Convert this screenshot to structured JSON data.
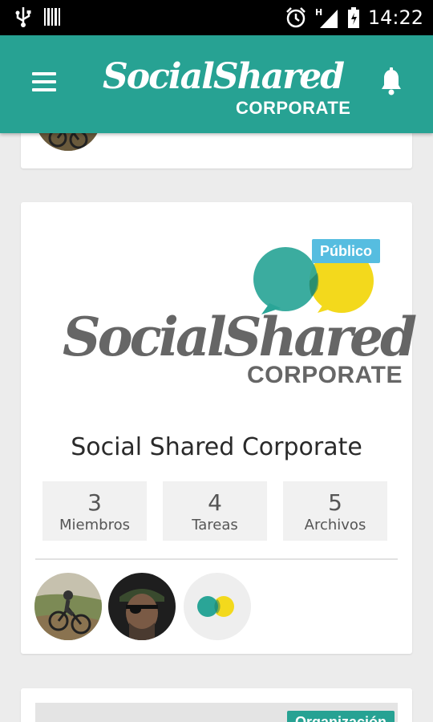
{
  "status_bar": {
    "time": "14:22",
    "icons": [
      "usb-icon",
      "barcode-icon",
      "alarm-icon",
      "signal-icon",
      "battery-icon"
    ]
  },
  "app_bar": {
    "logo_main": "SocialShared",
    "logo_sub": "CORPORATE",
    "icons": [
      "menu-icon",
      "bell-icon"
    ],
    "color": "#27a293"
  },
  "group_card": {
    "visibility": "Público",
    "cover_logo_main": "SocialShared",
    "cover_logo_sub": "CORPORATE",
    "title": "Social Shared Corporate",
    "stats": [
      {
        "value": "3",
        "label": "Miembros"
      },
      {
        "value": "4",
        "label": "Tareas"
      },
      {
        "value": "5",
        "label": "Archivos"
      }
    ],
    "members": [
      "member-cyclist-avatar",
      "member-soldier-avatar",
      "member-logo-avatar"
    ]
  },
  "next_card": {
    "badge": "Organización"
  },
  "colors": {
    "primary": "#27a293",
    "badge_public": "#56bde0",
    "logo_teal": "#2aa597",
    "logo_yellow": "#f3d91c"
  }
}
